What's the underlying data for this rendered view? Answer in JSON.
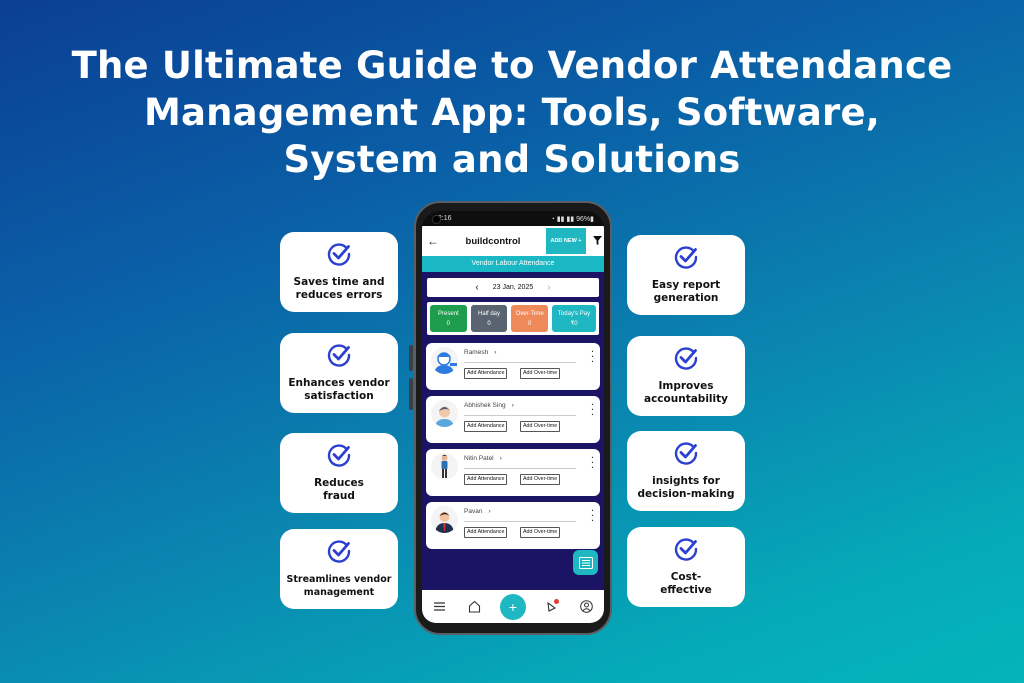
{
  "title": {
    "lines": [
      "The Ultimate Guide to Vendor Attendance",
      "Management App: Tools, Software,",
      "System and Solutions"
    ]
  },
  "colors": {
    "check_icon": "#2b3fd1",
    "teal_accent": "#1fb7c2",
    "screen_bg": "#1b1464",
    "present": "#1f9d4f",
    "half_day": "#5a6470",
    "over_time": "#ee8a5a",
    "todays_pay": "#1fb7c2",
    "notification_dot": "#e53935"
  },
  "benefits_left": [
    {
      "label_line1": "Saves time and",
      "label_line2": "reduces errors",
      "icon": "check-circle-icon"
    },
    {
      "label_line1": "Enhances vendor",
      "label_line2": "satisfaction",
      "icon": "check-circle-icon"
    },
    {
      "label_line1": "Reduces",
      "label_line2": "fraud",
      "icon": "check-circle-icon"
    },
    {
      "label_line1": "Streamlines vendor",
      "label_line2": "management",
      "icon": "check-circle-icon"
    }
  ],
  "benefits_right": [
    {
      "label_line1": "Easy report",
      "label_line2": "generation",
      "icon": "check-circle-icon"
    },
    {
      "label_line1": "Improves",
      "label_line2": "accountability",
      "icon": "check-circle-icon"
    },
    {
      "label_line1": "insights for",
      "label_line2": "decision-making",
      "icon": "check-circle-icon"
    },
    {
      "label_line1": "Cost-",
      "label_line2": "effective",
      "icon": "check-circle-icon"
    }
  ],
  "phone": {
    "status_bar": {
      "time": "12:16",
      "battery": "96%"
    },
    "app_bar": {
      "back_icon": "arrow-left-icon",
      "brand": "buildcontrol",
      "add_new": "ADD NEW +",
      "filter_icon": "filter-icon"
    },
    "section_title": "Vendor Labour Attendance",
    "date": {
      "value": "23 Jan, 2025",
      "prev_icon": "chevron-left-icon",
      "next_icon": "chevron-right-icon"
    },
    "stats": [
      {
        "label": "Present",
        "value": "0"
      },
      {
        "label": "Half day",
        "value": "0"
      },
      {
        "label": "Over-Time",
        "value": "0"
      },
      {
        "label": "Today's Pay",
        "value": "₹0"
      }
    ],
    "workers": [
      {
        "name": "Ramesh",
        "add_attendance": "Add Attendance",
        "add_overtime": "Add Over-time"
      },
      {
        "name": "Abhishek Sing",
        "add_attendance": "Add Attendance",
        "add_overtime": "Add Over-time"
      },
      {
        "name": "Nitin Patel",
        "add_attendance": "Add Attendance",
        "add_overtime": "Add Over-time"
      },
      {
        "name": "Pavan",
        "add_attendance": "Add Attendance",
        "add_overtime": "Add Over-time"
      }
    ],
    "bottom_nav": [
      "menu-icon",
      "home-icon",
      "plus-icon",
      "bell-icon",
      "profile-icon"
    ]
  }
}
